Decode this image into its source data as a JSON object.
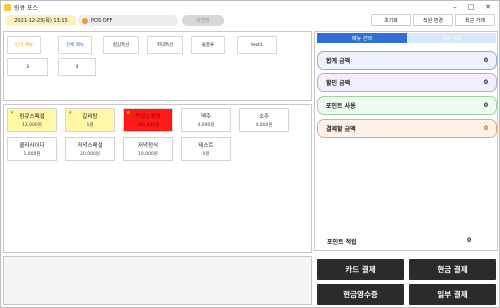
{
  "window": {
    "title": "링큐 포스",
    "minimize_icon": "minimize-icon",
    "maximize_icon": "maximize-icon",
    "close_icon": "close-icon"
  },
  "topbar": {
    "date": "2021-12-23(목) 13:15",
    "pos_status": "POS OFF",
    "lock_label": "화면잠",
    "buttons": [
      "초기화",
      "직원 변경",
      "최근 거래"
    ]
  },
  "categories": [
    "인기 메뉴",
    "전체 메뉴",
    "점심특선",
    "저녁특선",
    "술종류",
    "test1",
    "3",
    "4"
  ],
  "menu_items": [
    {
      "name": "링큐스페셜",
      "price": "12,000원",
      "bg": "#fff8a6",
      "star": true
    },
    {
      "name": "갈비탕",
      "price": "1원",
      "bg": "#fff8a6",
      "star": true
    },
    {
      "name": "맛있는종이",
      "price": "200,000원",
      "bg": "#ff1a1a",
      "star": true
    },
    {
      "name": "맥주",
      "price": "4,000원",
      "bg": "#ffffff",
      "star": false
    },
    {
      "name": "소주",
      "price": "4,000원",
      "bg": "#ffffff",
      "star": false
    },
    {
      "name": "콜라사이다",
      "price": "1,000원",
      "bg": "#ffffff",
      "star": false
    },
    {
      "name": "저녁스페셜",
      "price": "20,000원",
      "bg": "#ffffff",
      "star": false
    },
    {
      "name": "저녁정식",
      "price": "10,000원",
      "bg": "#ffffff",
      "star": false
    },
    {
      "name": "테스트",
      "price": "0원",
      "bg": "#ffffff",
      "star": false
    }
  ],
  "right": {
    "tab_active": "메뉴 선택",
    "tab_inactive": "결제 정보",
    "summary": [
      {
        "label": "합계 금액",
        "value": "0",
        "bg": "#eef3fb",
        "border": "#8ab0e0"
      },
      {
        "label": "할인 금액",
        "value": "0",
        "bg": "#f3eefb",
        "border": "#b9a6e0"
      },
      {
        "label": "포인트 사용",
        "value": "0",
        "bg": "#eefbee",
        "border": "#9fd39f"
      },
      {
        "label": "결제할 금액",
        "value": "0",
        "bg": "#fdf2ea",
        "border": "#f0a878",
        "value_color": "#e05a00"
      }
    ],
    "point_label": "포인트 적립",
    "point_value": "0",
    "pay_buttons": [
      "카드 결제",
      "현금 결제",
      "현금영수증",
      "일부 결제"
    ]
  },
  "colors": {
    "tab_active": "#2f6fd6",
    "tab_inactive": "#d9e6f7",
    "accent_orange": "#e0a030"
  }
}
